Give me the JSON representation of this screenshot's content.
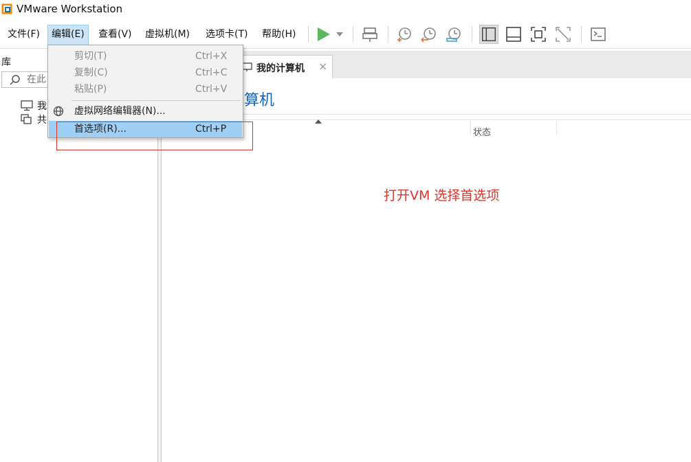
{
  "app": {
    "title": "VMware Workstation"
  },
  "menubar": {
    "items": [
      {
        "label": "文件(F)"
      },
      {
        "label": "编辑(E)"
      },
      {
        "label": "查看(V)"
      },
      {
        "label": "虚拟机(M)"
      },
      {
        "label": "选项卡(T)"
      },
      {
        "label": "帮助(H)"
      }
    ]
  },
  "toolbar": {
    "icons": [
      "play-icon",
      "dropdown-arrow-icon",
      "send-keys-icon",
      "snapshot-take-icon",
      "snapshot-revert-icon",
      "snapshot-manager-icon",
      "show-library-icon",
      "thumbnail-bar-icon",
      "full-screen-icon",
      "unity-icon",
      "console-view-icon"
    ],
    "accent_play": "#4caf50"
  },
  "library": {
    "title": "库",
    "search_placeholder": "在此",
    "items": [
      {
        "label": "我",
        "icon": "computer-icon"
      },
      {
        "label": "共",
        "icon": "shared-vms-icon"
      }
    ]
  },
  "tabs": [
    {
      "label": "我的计算机",
      "icon": "computer-icon",
      "close": "×"
    }
  ],
  "content": {
    "heading": "算机",
    "columns": [
      "状态"
    ]
  },
  "edit_menu": {
    "items": [
      {
        "label": "剪切(T)",
        "shortcut": "Ctrl+X",
        "disabled": true
      },
      {
        "label": "复制(C)",
        "shortcut": "Ctrl+C",
        "disabled": true
      },
      {
        "label": "粘贴(P)",
        "shortcut": "Ctrl+V",
        "disabled": true
      },
      {
        "label": "虚拟网络编辑器(N)...",
        "shortcut": "",
        "icon": "globe-icon"
      },
      {
        "label": "首选项(R)...",
        "shortcut": "Ctrl+P",
        "highlighted": true
      }
    ]
  },
  "annotation": {
    "note": "打开VM 选择首选项",
    "color": "#d9352b"
  },
  "colors": {
    "menu_active_bg": "#cce4f7",
    "menu_highlight": "#9fcff5",
    "heading_blue": "#1a63b0"
  }
}
